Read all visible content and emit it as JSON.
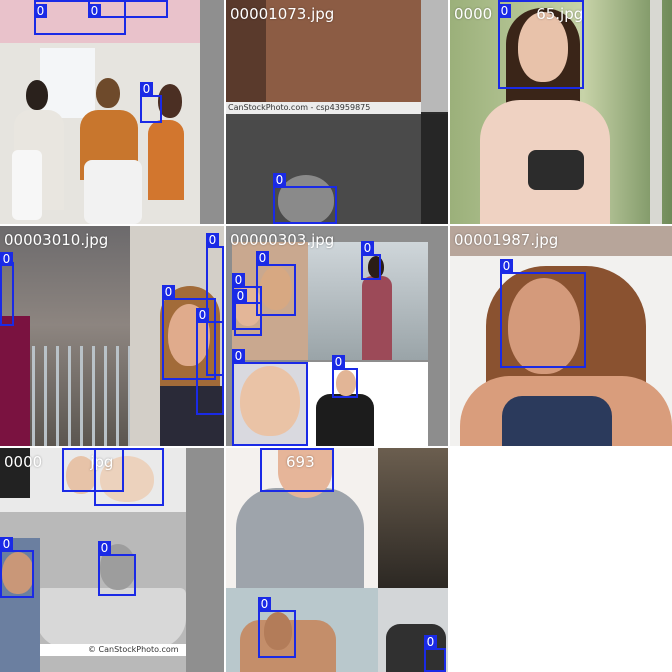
{
  "mosaic": {
    "background": "#ffffff",
    "box_color": "#1a2ae6",
    "tiles": [
      {
        "key": "t1",
        "filename": "",
        "label_visible": false
      },
      {
        "key": "t2",
        "filename": "00001073.jpg",
        "watermark": "CanStockPhoto.com - csp43959875"
      },
      {
        "key": "t3",
        "filename": "0000",
        "filename_tail": "65.jpg"
      },
      {
        "key": "t4",
        "filename": "00003010.jpg"
      },
      {
        "key": "t5",
        "filename": "00000303.jpg"
      },
      {
        "key": "t6",
        "filename": "00001987.jpg"
      },
      {
        "key": "t7",
        "filename": "0000",
        "filename_tail": "jpg",
        "watermark": "© CanStockPhoto.com"
      },
      {
        "key": "t8",
        "filename": "",
        "filename_tail": "693",
        "label_visible": false
      }
    ],
    "detections": {
      "class_id": "0"
    }
  }
}
